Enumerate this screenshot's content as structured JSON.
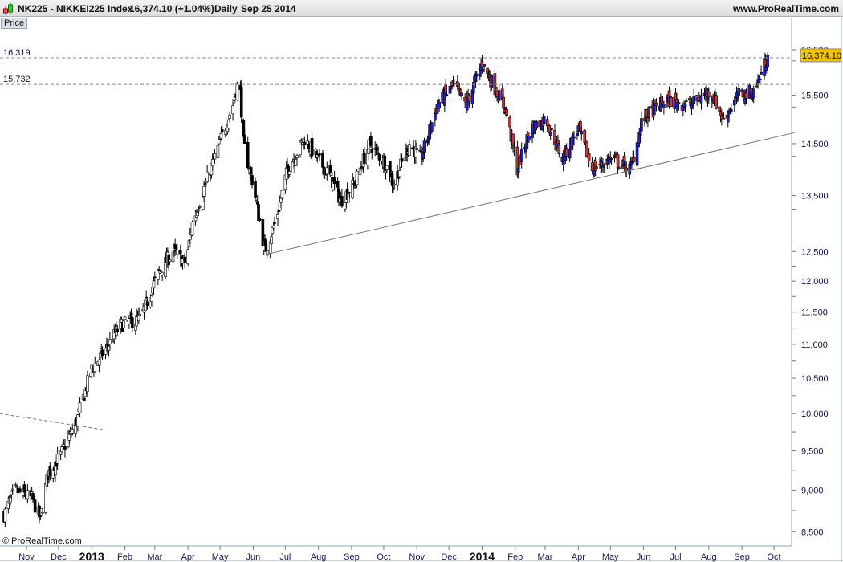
{
  "header": {
    "symbol": "NK225 - NIKKEI225 Index",
    "last": "16,374.10 (+1.04%)",
    "period": "Daily",
    "date": "Sep 25 2014",
    "site": "www.ProRealTime.com"
  },
  "panel_tab": "Price",
  "copyright": "© ProRealTime.com",
  "colors": {
    "up_recent": "#2222cc",
    "down_recent": "#cc3333",
    "price_tag": "#f2c200"
  },
  "chart_data": {
    "type": "candlestick",
    "title": "NK225 - NIKKEI225 Index",
    "yscale": "log",
    "ylim": [
      8400,
      17000
    ],
    "yticks": [
      {
        "v": 16500,
        "label": "16,500"
      },
      {
        "v": 15500,
        "label": "15,500"
      },
      {
        "v": 14500,
        "label": "14,500"
      },
      {
        "v": 13500,
        "label": "13,500"
      },
      {
        "v": 12500,
        "label": "12,500"
      },
      {
        "v": 12000,
        "label": "12,000"
      },
      {
        "v": 11500,
        "label": "11,500"
      },
      {
        "v": 11000,
        "label": "11,000"
      },
      {
        "v": 10500,
        "label": "10,500"
      },
      {
        "v": 10000,
        "label": "10,000"
      },
      {
        "v": 9500,
        "label": "9,500"
      },
      {
        "v": 9000,
        "label": "9,000"
      },
      {
        "v": 8500,
        "label": "8,500"
      }
    ],
    "xticks": [
      {
        "d": "2012-11-01",
        "label": "Nov"
      },
      {
        "d": "2012-12-01",
        "label": "Dec"
      },
      {
        "d": "2013-01-01",
        "label": "2013",
        "year": true
      },
      {
        "d": "2013-02-01",
        "label": "Feb"
      },
      {
        "d": "2013-03-01",
        "label": "Mar"
      },
      {
        "d": "2013-04-01",
        "label": "Apr"
      },
      {
        "d": "2013-05-01",
        "label": "May"
      },
      {
        "d": "2013-06-01",
        "label": "Jun"
      },
      {
        "d": "2013-07-01",
        "label": "Jul"
      },
      {
        "d": "2013-08-01",
        "label": "Aug"
      },
      {
        "d": "2013-09-01",
        "label": "Sep"
      },
      {
        "d": "2013-10-01",
        "label": "Oct"
      },
      {
        "d": "2013-11-01",
        "label": "Nov"
      },
      {
        "d": "2013-12-01",
        "label": "Dec"
      },
      {
        "d": "2014-01-01",
        "label": "2014",
        "year": true
      },
      {
        "d": "2014-02-01",
        "label": "Feb"
      },
      {
        "d": "2014-03-01",
        "label": "Mar"
      },
      {
        "d": "2014-04-01",
        "label": "Apr"
      },
      {
        "d": "2014-05-01",
        "label": "May"
      },
      {
        "d": "2014-06-01",
        "label": "Jun"
      },
      {
        "d": "2014-07-01",
        "label": "Jul"
      },
      {
        "d": "2014-08-01",
        "label": "Aug"
      },
      {
        "d": "2014-09-01",
        "label": "Sep"
      },
      {
        "d": "2014-10-01",
        "label": "Oct"
      }
    ],
    "price_path": [
      [
        "2012-10-11",
        8700
      ],
      [
        "2012-10-21",
        9000
      ],
      [
        "2012-11-06",
        8900
      ],
      [
        "2012-11-14",
        8650
      ],
      [
        "2012-11-21",
        9200
      ],
      [
        "2012-12-03",
        9450
      ],
      [
        "2012-12-18",
        9900
      ],
      [
        "2012-12-31",
        10600
      ],
      [
        "2013-01-13",
        10900
      ],
      [
        "2013-01-28",
        11300
      ],
      [
        "2013-02-16",
        11400
      ],
      [
        "2013-03-03",
        12100
      ],
      [
        "2013-03-18",
        12500
      ],
      [
        "2013-03-30",
        12300
      ],
      [
        "2013-04-05",
        13000
      ],
      [
        "2013-04-17",
        13700
      ],
      [
        "2013-05-02",
        14600
      ],
      [
        "2013-05-13",
        15300
      ],
      [
        "2013-05-19",
        15900
      ],
      [
        "2013-05-23",
        14500
      ],
      [
        "2013-06-01",
        13700
      ],
      [
        "2013-06-12",
        12500
      ],
      [
        "2013-06-23",
        13100
      ],
      [
        "2013-07-03",
        14000
      ],
      [
        "2013-07-19",
        14600
      ],
      [
        "2013-07-31",
        14200
      ],
      [
        "2013-08-11",
        13900
      ],
      [
        "2013-08-22",
        13400
      ],
      [
        "2013-09-03",
        13700
      ],
      [
        "2013-09-18",
        14500
      ],
      [
        "2013-10-03",
        14100
      ],
      [
        "2013-10-10",
        13700
      ],
      [
        "2013-10-25",
        14500
      ],
      [
        "2013-11-05",
        14200
      ],
      [
        "2013-11-20",
        15300
      ],
      [
        "2013-12-05",
        15700
      ],
      [
        "2013-12-17",
        15300
      ],
      [
        "2014-01-01",
        16200
      ],
      [
        "2014-01-12",
        15700
      ],
      [
        "2014-01-23",
        15200
      ],
      [
        "2014-02-03",
        14000
      ],
      [
        "2014-02-15",
        14800
      ],
      [
        "2014-03-02",
        15000
      ],
      [
        "2014-03-17",
        14200
      ],
      [
        "2014-04-01",
        14800
      ],
      [
        "2014-04-14",
        14000
      ],
      [
        "2014-05-01",
        14200
      ],
      [
        "2014-05-20",
        14000
      ],
      [
        "2014-05-31",
        15000
      ],
      [
        "2014-06-22",
        15400
      ],
      [
        "2014-07-15",
        15300
      ],
      [
        "2014-08-03",
        15600
      ],
      [
        "2014-08-14",
        15000
      ],
      [
        "2014-08-29",
        15500
      ],
      [
        "2014-09-13",
        15600
      ],
      [
        "2014-09-25",
        16374.1
      ]
    ],
    "levels": [
      {
        "v": 16319,
        "label": "16,319"
      },
      {
        "v": 15732,
        "label": "15,732"
      }
    ],
    "trendline": [
      [
        "2013-06-13",
        12450
      ],
      [
        "2014-10-20",
        14720
      ]
    ],
    "old_trendline": [
      [
        "2012-10-07",
        10000
      ],
      [
        "2013-01-13",
        9780
      ]
    ],
    "last_price": {
      "v": 16374.1,
      "label": "16,374.10"
    }
  }
}
